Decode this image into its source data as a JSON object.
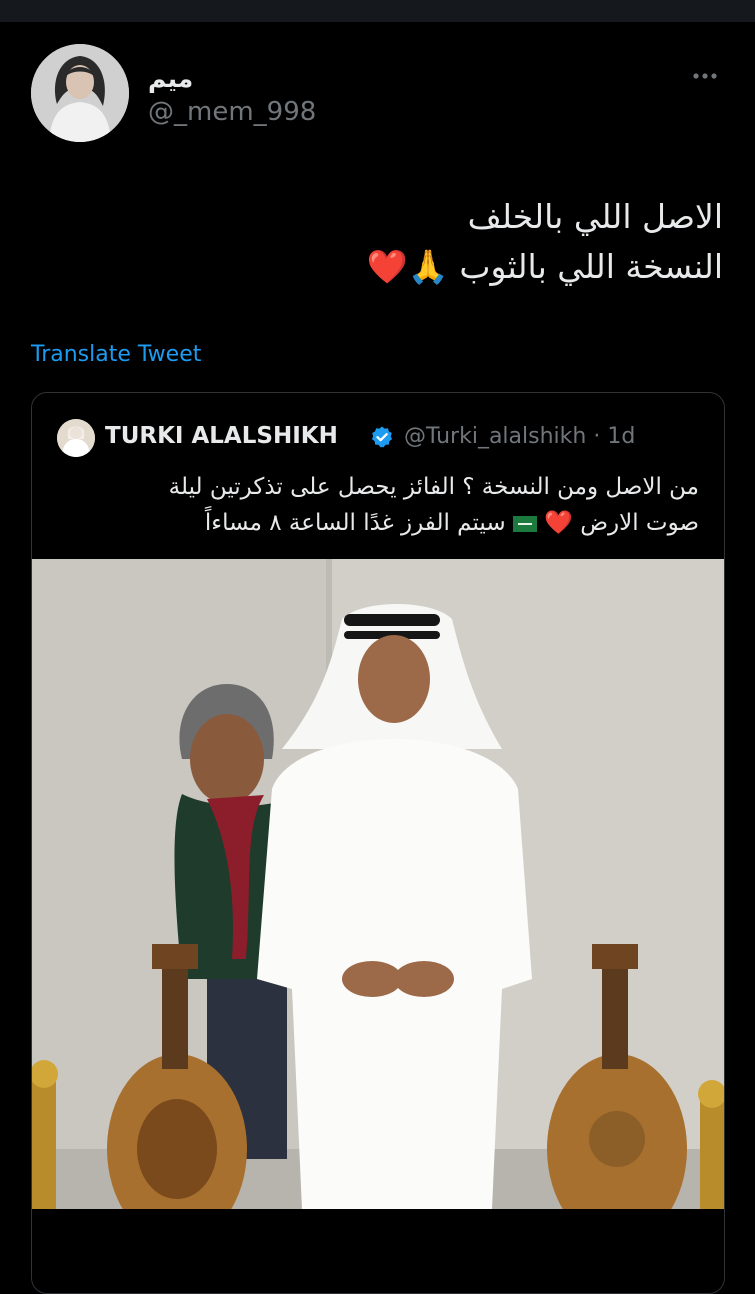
{
  "tweet": {
    "display_name": "ميم",
    "handle": "@_mem_998",
    "text_lines": [
      "الاصل اللي بالخلف",
      "النسخة اللي بالثوب 🙏❤️"
    ],
    "translate_label": "Translate Tweet"
  },
  "quote": {
    "display_name": "TURKI ALALSHIKH",
    "handle": "@Turki_alalshikh",
    "separator": "·",
    "age": "1d",
    "text_line1": "من الاصل ومن النسخة ؟ الفائز يحصل على تذكرتين ليلة",
    "text_line2_start": "صوت الارض ❤️",
    "text_line2_end": "سيتم الفرز غدًا الساعة ٨ مساءاً"
  },
  "icons": {
    "more": "more-horizontal-icon",
    "verified": "verified-badge-icon",
    "flag": "saudi-flag-icon"
  },
  "colors": {
    "background": "#000000",
    "text": "#e7e9ea",
    "secondary_text": "#71767b",
    "link": "#1d9bf0",
    "verified": "#1d9bf0",
    "border": "#2f3336"
  }
}
